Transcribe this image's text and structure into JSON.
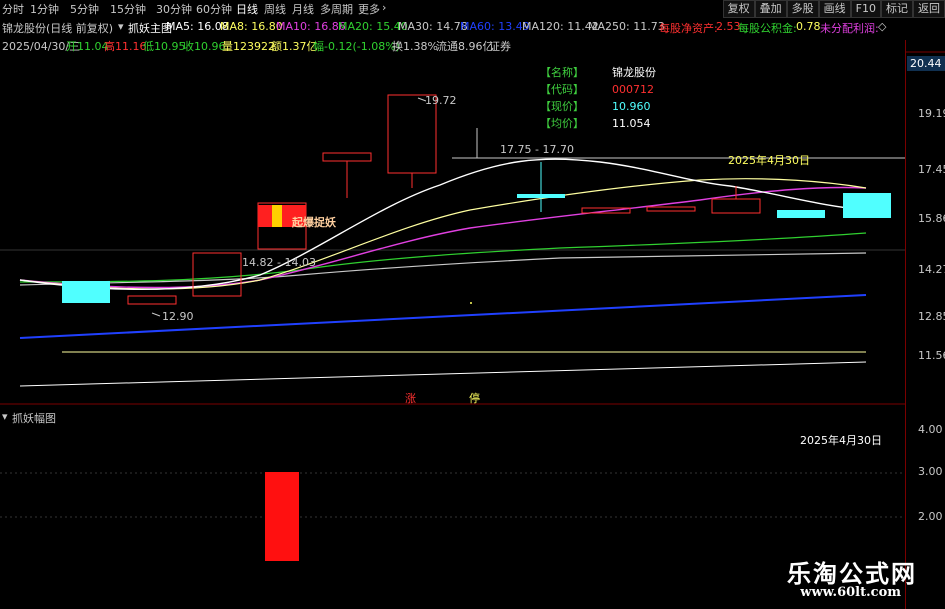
{
  "toolbar": {
    "items": [
      "分时",
      "1分钟",
      "5分钟",
      "15分钟",
      "30分钟",
      "60分钟",
      "日线",
      "周线",
      "月线",
      "多周期",
      "更多"
    ],
    "active": "日线",
    "right_buttons": [
      "复权",
      "叠加",
      "多股",
      "画线",
      "F10",
      "标记",
      "返回"
    ]
  },
  "ma_line": {
    "title": "锦龙股份(日线 前复权)",
    "indicator": "抓妖主图",
    "ma5": "MA5: 16.08",
    "ma8": "MA8: 16.80",
    "ma10": "MA10: 16.86",
    "ma20": "MA20: 15.40",
    "ma30": "MA30: 14.78",
    "ma60": "MA60: 13.49",
    "ma120": "MA120: 11.42",
    "ma250": "MA250: 11.73",
    "extra1_label": "每股净资产:",
    "extra1_val": "2.53",
    "extra2_label": "每股公积金:",
    "extra2_val": "0.78",
    "extra3_label": "未分配利润:"
  },
  "info_line": {
    "date": "2025/04/30/三",
    "open": "开11.04",
    "high": "高11.16",
    "low": "低10.95",
    "close": "收10.96",
    "vol": "量123922",
    "amount": "额1.37亿",
    "chg": "幅-0.12(-1.08%)",
    "turnover": "换1.38%",
    "float": "流通8.96亿",
    "type": "证券"
  },
  "price_axis": [
    "20.44",
    "19.19",
    "17.45",
    "15.86",
    "14.27",
    "12.85",
    "11.56"
  ],
  "sub_axis": [
    "4.00",
    "3.00",
    "2.00"
  ],
  "stock_box": {
    "name_key": "【名称】",
    "name_val": "锦龙股份",
    "code_key": "【代码】",
    "code_val": "000712",
    "now_key": "【现价】",
    "now_val": "10.960",
    "avg_key": "【均价】",
    "avg_val": "11.054"
  },
  "annotations": {
    "a1": "19.72",
    "a2": "17.75 - 17.70",
    "a3": "14.82 - 14.03",
    "a4": "12.90",
    "a5": "起爆捉妖",
    "a6": "2025年4月30日",
    "zhang": "涨",
    "ting": "停"
  },
  "sub_panel": {
    "title": "抓妖幅图",
    "date": "2025年4月30日"
  },
  "watermark": {
    "cn": "乐淘公式网",
    "url": "www.60lt.com"
  },
  "colors": {
    "ma5": "#ffffff",
    "ma10": "#e040e0",
    "ma20": "#30d030",
    "ma60": "#2040ff",
    "up": "#ff3030",
    "down": "#50ffff"
  }
}
